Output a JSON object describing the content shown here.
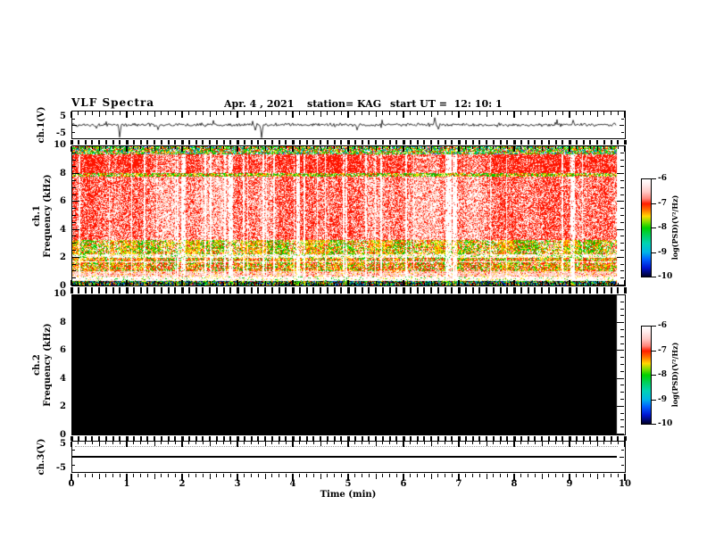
{
  "header": {
    "title": "VLF Spectra",
    "date": "Apr. 4 , 2021",
    "station": "station= KAG",
    "start_ut": "start UT =  12: 10: 1"
  },
  "xaxis": {
    "label": "Time (min)",
    "tick_labels": [
      "0",
      "1",
      "2",
      "3",
      "4",
      "5",
      "6",
      "7",
      "8",
      "9",
      "10"
    ],
    "minor_ticks_per_major": 8
  },
  "panels": {
    "ch1_wave": {
      "ylabel": "ch.1(V)",
      "ytick_labels": [
        "5",
        "-5"
      ]
    },
    "ch1_spec": {
      "ylabel_line1": "ch.1",
      "ylabel_line2": "Frequency (kHz)",
      "ytick_labels": [
        "10",
        "8",
        "6",
        "4",
        "2",
        "0"
      ]
    },
    "ch2_spec": {
      "ylabel_line1": "ch.2",
      "ylabel_line2": "Frequency (kHz)",
      "ytick_labels": [
        "10",
        "8",
        "6",
        "4",
        "2",
        "0"
      ]
    },
    "ch3_wave": {
      "ylabel": "ch.3(V)",
      "ytick_labels": [
        "5",
        "-5"
      ]
    }
  },
  "colorbar": {
    "label": "log(PSD)(V²/Hz)",
    "tick_labels": [
      "-6",
      "-7",
      "-8",
      "-9",
      "-10"
    ],
    "gradient": [
      [
        "#ffffff",
        0.0
      ],
      [
        "#ffeaea",
        0.06
      ],
      [
        "#ffc8c4",
        0.13
      ],
      [
        "#ff8478",
        0.2
      ],
      [
        "#ff1e00",
        0.25
      ],
      [
        "#ff6a00",
        0.31
      ],
      [
        "#ffd800",
        0.38
      ],
      [
        "#7ddc00",
        0.44
      ],
      [
        "#00d000",
        0.5
      ],
      [
        "#00d060",
        0.58
      ],
      [
        "#00d2b4",
        0.66
      ],
      [
        "#00b4e6",
        0.75
      ],
      [
        "#0064ff",
        0.82
      ],
      [
        "#0014d2",
        0.91
      ],
      [
        "#000028",
        1.0
      ]
    ]
  },
  "chart_data": [
    {
      "type": "line",
      "name": "ch1_waveform",
      "ylabel": "ch.1(V)",
      "ylim": [
        -5,
        5
      ],
      "xlim": [
        0,
        10
      ],
      "description": "noisy voltage trace fluctuating around 0 V with sporadic impulsive spikes",
      "baseline": 0,
      "noise_amplitude": 0.6,
      "spikes": [
        {
          "t": 0.85,
          "v": -4.6
        },
        {
          "t": 1.55,
          "v": -1.8
        },
        {
          "t": 3.3,
          "v": -2.0
        },
        {
          "t": 3.42,
          "v": -4.8
        },
        {
          "t": 5.15,
          "v": -1.9
        },
        {
          "t": 6.55,
          "v": 2.7
        },
        {
          "t": 6.62,
          "v": -1.6
        },
        {
          "t": 9.05,
          "v": 1.8
        }
      ]
    },
    {
      "type": "heatmap",
      "name": "ch1_spectrogram",
      "ylabel": "Frequency (kHz)",
      "ylim": [
        0,
        10
      ],
      "xlim": [
        0,
        9.83
      ],
      "value_scale": {
        "min": -10,
        "max": -6,
        "label": "log(PSD)(V²/Hz)"
      },
      "description": "broadband VLF activity: intense red emissions 3-9.5 kHz interrupted by white vertical dropouts; green/yellow bands near 8 kHz and 10 kHz; yellow-green patchy bands 1-3.3 kHz; pink stripes below 1 kHz; dark speckled band at 0 kHz",
      "white_lines_khz": [
        1.72
      ],
      "dropout_probability": 0.05,
      "bands": [
        {
          "f": [
            9.45,
            10.0
          ],
          "mode": "speckle",
          "colors": [
            [
              "#00c800",
              0.32
            ],
            [
              "#ff1400",
              0.22
            ],
            [
              "#ffe400",
              0.14
            ],
            [
              "#00c8c8",
              0.1
            ],
            [
              "#0050ff",
              0.05
            ],
            [
              "#ffffff",
              0.17
            ]
          ]
        },
        {
          "f": [
            8.05,
            9.45
          ],
          "mode": "column",
          "colors": [
            [
              "#ff1400",
              0.8
            ],
            [
              "#ffb4a0",
              0.1
            ],
            [
              "#ffffff",
              0.1
            ]
          ]
        },
        {
          "f": [
            7.8,
            8.05
          ],
          "mode": "speckle",
          "colors": [
            [
              "#00c800",
              0.34
            ],
            [
              "#ffe400",
              0.26
            ],
            [
              "#ff1400",
              0.22
            ],
            [
              "#ffffff",
              0.18
            ]
          ]
        },
        {
          "f": [
            3.3,
            7.8
          ],
          "mode": "column",
          "colors": [
            [
              "#ff1400",
              0.6
            ],
            [
              "#ffb4a0",
              0.16
            ],
            [
              "#ffffff",
              0.24
            ]
          ]
        },
        {
          "f": [
            2.25,
            3.3
          ],
          "mode": "blocks",
          "colors": [
            [
              "#ffe400",
              0.26
            ],
            [
              "#ff7a00",
              0.12
            ],
            [
              "#00c800",
              0.2
            ],
            [
              "#ff1400",
              0.22
            ],
            [
              "#ffffff",
              0.2
            ]
          ]
        },
        {
          "f": [
            2.0,
            2.25
          ],
          "mode": "speckle",
          "colors": [
            [
              "#ffffff",
              0.66
            ],
            [
              "#00c800",
              0.1
            ],
            [
              "#ffe400",
              0.1
            ],
            [
              "#ffb4a0",
              0.14
            ]
          ]
        },
        {
          "f": [
            1.05,
            2.0
          ],
          "mode": "column",
          "colors": [
            [
              "#ffe400",
              0.3
            ],
            [
              "#ff7a00",
              0.16
            ],
            [
              "#00c800",
              0.16
            ],
            [
              "#ff1400",
              0.22
            ],
            [
              "#ffffff",
              0.16
            ]
          ]
        },
        {
          "f": [
            0.62,
            1.05
          ],
          "mode": "stripes",
          "colors": [
            [
              "#ffb4a0",
              0.42
            ],
            [
              "#ffffff",
              0.34
            ],
            [
              "#ff1400",
              0.14
            ],
            [
              "#ffe400",
              0.1
            ]
          ]
        },
        {
          "f": [
            0.32,
            0.62
          ],
          "mode": "speckle",
          "colors": [
            [
              "#ffffff",
              0.8
            ],
            [
              "#ffb4a0",
              0.08
            ],
            [
              "#ffe400",
              0.06
            ],
            [
              "#00c800",
              0.06
            ]
          ]
        },
        {
          "f": [
            0.0,
            0.32
          ],
          "mode": "dark",
          "colors": [
            [
              "#000000",
              0.34
            ],
            [
              "#0040d0",
              0.18
            ],
            [
              "#00c800",
              0.16
            ],
            [
              "#ff1400",
              0.12
            ],
            [
              "#ffe400",
              0.1
            ],
            [
              "#00c8c8",
              0.1
            ]
          ]
        }
      ]
    },
    {
      "type": "heatmap",
      "name": "ch2_spectrogram",
      "ylabel": "Frequency (kHz)",
      "ylim": [
        0,
        10
      ],
      "xlim": [
        0,
        9.83
      ],
      "fill": "#000000",
      "description": "no signal recorded - uniform minimum power (solid black)"
    },
    {
      "type": "line",
      "name": "ch3_waveform",
      "ylabel": "ch.3(V)",
      "ylim": [
        -5,
        5
      ],
      "xlim": [
        0,
        10
      ],
      "constant": 0,
      "description": "flat line at 0 V with faint dotted reference trace near +3.5 V"
    }
  ]
}
